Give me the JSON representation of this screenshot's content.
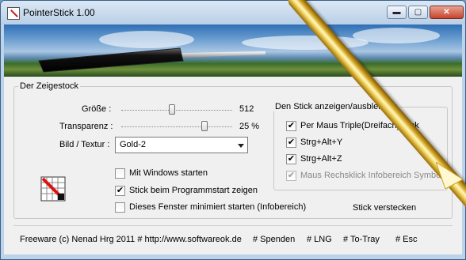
{
  "window": {
    "title": "PointerStick 1.00",
    "minimize": "▬",
    "maximize": "▢",
    "close": "✕"
  },
  "group_stick": {
    "label": "Der Zeigestock",
    "size_label": "Größe :",
    "size_value": "512",
    "size_fraction": 0.46,
    "transparency_label": "Transparenz :",
    "transparency_value": "25 %",
    "transparency_fraction": 0.75,
    "texture_label": "Bild / Textur :",
    "texture_selected": "Gold-2"
  },
  "group_show": {
    "label": "Den Stick anzeigen/ausblenden",
    "items": [
      {
        "label": "Per Maus Triple(Dreifach) klick",
        "checked": true,
        "enabled": true
      },
      {
        "label": "Strg+Alt+Y",
        "checked": true,
        "enabled": true
      },
      {
        "label": "Strg+Alt+Z",
        "checked": true,
        "enabled": true
      },
      {
        "label": "Maus Rechsklick Infobereich Symbol",
        "checked": true,
        "enabled": false
      }
    ]
  },
  "options": [
    {
      "label": "Mit Windows starten",
      "checked": false
    },
    {
      "label": "Stick beim Programmstart zeigen",
      "checked": true
    },
    {
      "label": "Dieses Fenster minimiert starten (Infobereich)",
      "checked": false
    }
  ],
  "hide_stick_button": "Stick verstecken",
  "status_bar": {
    "copyright": "Freeware (c) Nenad Hrg 2011 # http://www.softwareok.de",
    "links": [
      "# Spenden",
      "# LNG",
      "# To-Tray",
      "# Esc"
    ]
  },
  "colors": {
    "titlebar": "#c9dbee",
    "client": "#f0f0f0",
    "close_button": "#c7452a",
    "stick_gold": "#e8c445"
  }
}
